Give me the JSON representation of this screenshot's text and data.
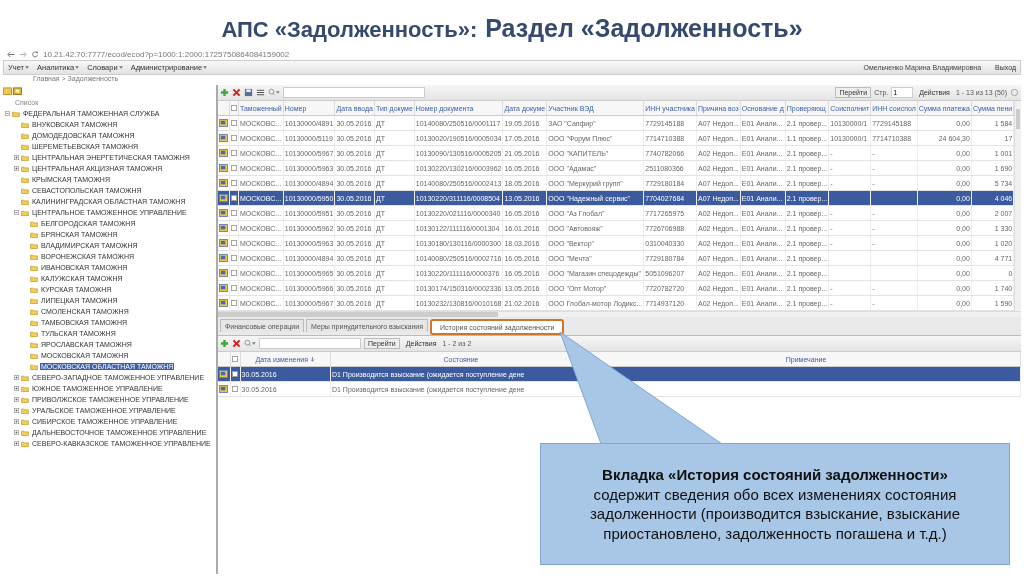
{
  "slide_title": {
    "part1": "АПС «Задолженность»:",
    "part2": "Раздел «Задолженность»"
  },
  "browser": {
    "url": "10.21.42.70:7777/ecod/ecod?p=1000:1:2000:1725750864084159002"
  },
  "menu": [
    {
      "label": "Учет"
    },
    {
      "label": "Аналитика"
    },
    {
      "label": "Словари"
    },
    {
      "label": "Администрирование"
    }
  ],
  "user": "Омельченко Марина Владимировна",
  "logout": "Выход",
  "breadcrumb": "Главная > Задолженность",
  "tree": {
    "label": "Список",
    "items": [
      {
        "label": "ФЕДЕРАЛЬНАЯ ТАМОЖЕННАЯ СЛУЖБА",
        "expanded": true,
        "selected": false,
        "children": [
          {
            "label": "ВНУКОВСКАЯ ТАМОЖНЯ",
            "selected": false
          },
          {
            "label": "ДОМОДЕДОВСКАЯ ТАМОЖНЯ",
            "selected": false
          },
          {
            "label": "ШЕРЕМЕТЬЕВСКАЯ ТАМОЖНЯ",
            "selected": false
          },
          {
            "label": "ЦЕНТРАЛЬНАЯ ЭНЕРГЕТИЧЕСКАЯ ТАМОЖНЯ",
            "expanded": false,
            "selected": false
          },
          {
            "label": "ЦЕНТРАЛЬНАЯ АКЦИЗНАЯ ТАМОЖНЯ",
            "expanded": false,
            "selected": false
          },
          {
            "label": "КРЫМСКАЯ ТАМОЖНЯ",
            "selected": false
          },
          {
            "label": "СЕВАСТОПОЛЬСКАЯ ТАМОЖНЯ",
            "selected": false
          },
          {
            "label": "КАЛИНИНГРАДСКАЯ ОБЛАСТНАЯ ТАМОЖНЯ",
            "selected": false
          },
          {
            "label": "ЦЕНТРАЛЬНОЕ ТАМОЖЕННОЕ УПРАВЛЕНИЕ",
            "expanded": true,
            "selected": false,
            "children": [
              {
                "label": "БЕЛГОРОДСКАЯ ТАМОЖНЯ",
                "selected": false
              },
              {
                "label": "БРЯНСКАЯ ТАМОЖНЯ",
                "selected": false
              },
              {
                "label": "ВЛАДИМИРСКАЯ ТАМОЖНЯ",
                "selected": false
              },
              {
                "label": "ВОРОНЕЖСКАЯ ТАМОЖНЯ",
                "selected": false
              },
              {
                "label": "ИВАНОВСКАЯ ТАМОЖНЯ",
                "selected": false
              },
              {
                "label": "КАЛУЖСКАЯ ТАМОЖНЯ",
                "selected": false
              },
              {
                "label": "КУРСКАЯ ТАМОЖНЯ",
                "selected": false
              },
              {
                "label": "ЛИПЕЦКАЯ ТАМОЖНЯ",
                "selected": false
              },
              {
                "label": "СМОЛЕНСКАЯ ТАМОЖНЯ",
                "selected": false
              },
              {
                "label": "ТАМБОВСКАЯ ТАМОЖНЯ",
                "selected": false
              },
              {
                "label": "ТУЛЬСКАЯ ТАМОЖНЯ",
                "selected": false
              },
              {
                "label": "ЯРОСЛАВСКАЯ ТАМОЖНЯ",
                "selected": false
              },
              {
                "label": "МОСКОВСКАЯ ТАМОЖНЯ",
                "selected": false
              },
              {
                "label": "МОСКОВСКАЯ ОБЛАСТНАЯ ТАМОЖНЯ",
                "selected": true
              }
            ]
          },
          {
            "label": "СЕВЕРО-ЗАПАДНОЕ ТАМОЖЕННОЕ УПРАВЛЕНИЕ",
            "expanded": false,
            "selected": false
          },
          {
            "label": "ЮЖНОЕ ТАМОЖЕННОЕ УПРАВЛЕНИЕ",
            "expanded": false,
            "selected": false
          },
          {
            "label": "ПРИВОЛЖСКОЕ ТАМОЖЕННОЕ УПРАВЛЕНИЕ",
            "expanded": false,
            "selected": false
          },
          {
            "label": "УРАЛЬСКОЕ ТАМОЖЕННОЕ УПРАВЛЕНИЕ",
            "expanded": false,
            "selected": false
          },
          {
            "label": "СИБИРСКОЕ ТАМОЖЕННОЕ УПРАВЛЕНИЕ",
            "expanded": false,
            "selected": false
          },
          {
            "label": "ДАЛЬНЕВОСТОЧНОЕ ТАМОЖЕННОЕ УПРАВЛЕНИЕ",
            "expanded": false,
            "selected": false
          },
          {
            "label": "СЕВЕРО-КАВКАЗСКОЕ ТАМОЖЕННОЕ УПРАВЛЕНИЕ",
            "expanded": false,
            "selected": false
          }
        ]
      }
    ]
  },
  "grid": {
    "select_all": {
      "checked": false
    },
    "go": "Перейти",
    "page_label": "Стр.",
    "page": "1",
    "actions": "Действия",
    "paging": "1 - 13 из 13 (50)",
    "columns": [
      "Таможенный",
      "Номер",
      "Дата ввода",
      "Тип докуме",
      "Номер документа",
      "Дата докуме",
      "Участник ВЭД",
      "ИНН участника",
      "Причина воз",
      "Основание д",
      "Проверяющ",
      "Соисполнит",
      "ИНН соиспол",
      "Сумма платежа",
      "Сумма пени"
    ],
    "rows": [
      {
        "selected": false,
        "cells": [
          "МОСКОВС...",
          "10130000/4891",
          "30.05.2016",
          "ДТ",
          "10140080/250516/0001117",
          "19.05.2016",
          "ЗАО \"Сапфир\"",
          "7729145188",
          "А07 Недоп...",
          "Е01 Анали...",
          "2.1 провер...",
          "10130000/1",
          "7729145188",
          "0,00",
          "1 584"
        ]
      },
      {
        "selected": false,
        "cells": [
          "МОСКОВС...",
          "10130000/5119",
          "30.05.2016",
          "ДТ",
          "10130020/190516/0005034",
          "17.05.2016",
          "ООО \"Форум Плюс\"",
          "7714710388",
          "А07 Недоп...",
          "Е01 Анали...",
          "1.1 провер...",
          "10130000/1",
          "7714710388",
          "24 604,30",
          "17"
        ]
      },
      {
        "selected": false,
        "cells": [
          "МОСКОВС...",
          "10130000/5967",
          "30.05.2016",
          "ДТ",
          "10130090/130516/0005205",
          "21.05.2016",
          "ООО \"КАПИТЕЛЬ\"",
          "7740782066",
          "А02 Недоп...",
          "Е01 Анали...",
          "2.1 провер...",
          "-",
          "-",
          "0,00",
          "1 001"
        ]
      },
      {
        "selected": false,
        "cells": [
          "МОСКОВС...",
          "10130000/5963",
          "30.05.2016",
          "ДТ",
          "10130220/130216/0003962",
          "16.05.2016",
          "ООО \"Адамас\"",
          "2511080366",
          "А02 Недоп...",
          "Е01 Анали...",
          "2.1 провер...",
          "-",
          "-",
          "0,00",
          "1 690"
        ]
      },
      {
        "selected": false,
        "cells": [
          "МОСКОВС...",
          "10130000/4894",
          "30.05.2016",
          "ДТ",
          "10140080/250516/0002413",
          "18.05.2016",
          "ООО \"Меркурий групп\"",
          "7729180184",
          "А07 Недоп...",
          "Е01 Анали...",
          "2.1 провер...",
          "-",
          "-",
          "0,00",
          "5 734"
        ]
      },
      {
        "selected": true,
        "cells": [
          "МОСКОВС...",
          "10130000/5950",
          "30.05.2016",
          "ДТ",
          "10130220/311116/0008504",
          "13.05.2016",
          "ООО \"Надежный сервис\"",
          "7704027684",
          "А07 Недоп...",
          "Е01 Анали...",
          "2.1 провер...",
          "",
          "",
          "0,00",
          "4 046"
        ]
      },
      {
        "selected": false,
        "cells": [
          "МОСКОВС...",
          "10130000/5951",
          "30.05.2016",
          "ДТ",
          "10130220/021116/0000340",
          "16.05.2016",
          "ООО \"Аз Глобал\"",
          "7717265975",
          "А02 Недоп...",
          "Е01 Анали...",
          "2.1 провер...",
          "-",
          "-",
          "0,00",
          "2 007"
        ]
      },
      {
        "selected": false,
        "cells": [
          "МОСКОВС...",
          "10130000/5962",
          "30.05.2016",
          "ДТ",
          "10130122/111116/0001304",
          "16.01.2016",
          "ООО \"Автовояж\"",
          "7726706988",
          "А02 Недоп...",
          "Е01 Анали...",
          "2.1 провер...",
          "-",
          "-",
          "0,00",
          "1 330"
        ]
      },
      {
        "selected": false,
        "cells": [
          "МОСКОВС...",
          "10130000/5963",
          "30.05.2016",
          "ДТ",
          "10130180/130116/0000300",
          "18.03.2016",
          "ООО \"Вектор\"",
          "0310040330",
          "А02 Недоп...",
          "Е01 Анали...",
          "2.1 провер...",
          "-",
          "-",
          "0,00",
          "1 020"
        ]
      },
      {
        "selected": false,
        "cells": [
          "МОСКОВС...",
          "10130000/4894",
          "30.05.2016",
          "ДТ",
          "10140080/250516/0002716",
          "16.05.2016",
          "ООО \"Мечта\"",
          "7729180784",
          "А07 Недоп...",
          "Е01 Анали...",
          "2.1 провер...",
          "",
          "",
          "0,00",
          "4 771"
        ]
      },
      {
        "selected": false,
        "cells": [
          "МОСКОВС...",
          "10130000/5965",
          "30.05.2016",
          "ДТ",
          "10130220/111116/0000376",
          "16.05.2016",
          "ООО \"Магазин спецодежды\"",
          "5051096207",
          "А02 Недоп...",
          "Е01 Анали...",
          "2.1 провер...",
          "",
          "",
          "0,00",
          "0"
        ]
      },
      {
        "selected": false,
        "cells": [
          "МОСКОВС...",
          "10130000/5966",
          "30.05.2016",
          "ДТ",
          "10130174/150316/0002336",
          "13.05.2016",
          "ООО \"Опт Мотор\"",
          "7720782720",
          "А02 Недоп...",
          "Е01 Анали...",
          "2.1 провер...",
          "-",
          "-",
          "0,00",
          "1 740"
        ]
      },
      {
        "selected": false,
        "cells": [
          "МОСКОВС...",
          "10130000/5967",
          "30.05.2016",
          "ДТ",
          "10130232/130816/0010168",
          "21.02.2016",
          "ООО Глобал-мотор Лодикс...",
          "7714937120",
          "А02 Недоп...",
          "Е01 Анали...",
          "2.1 провер...",
          "-",
          "-",
          "0,00",
          "1 590"
        ]
      }
    ]
  },
  "tabs": [
    {
      "label": "Финансовые операции",
      "selected": false
    },
    {
      "label": "Меры принудительного взыскания",
      "selected": false
    },
    {
      "label": "История состояний задолженности",
      "selected": true
    }
  ],
  "history": {
    "select_all": {
      "checked": false
    },
    "go": "Перейти",
    "actions": "Действия",
    "paging": "1 - 2 из 2",
    "columns": [
      "Дата изменения",
      "Состояние",
      "Примечание"
    ],
    "rows": [
      {
        "selected": true,
        "cells": [
          "30.05.2016",
          "D1 Производится взыскание (ожидается поступление дене",
          ""
        ]
      },
      {
        "selected": false,
        "cells": [
          "30.05.2016",
          "D1 Производится взыскание (ожидается поступление дене",
          ""
        ]
      }
    ]
  },
  "callout": {
    "title": "Вкладка «История состояний задолженности»",
    "body": "содержит сведения обо всех изменениях состояния задолженности (производится взыскание, взыскание приостановлено, задолженность погашена и т.д.)"
  }
}
